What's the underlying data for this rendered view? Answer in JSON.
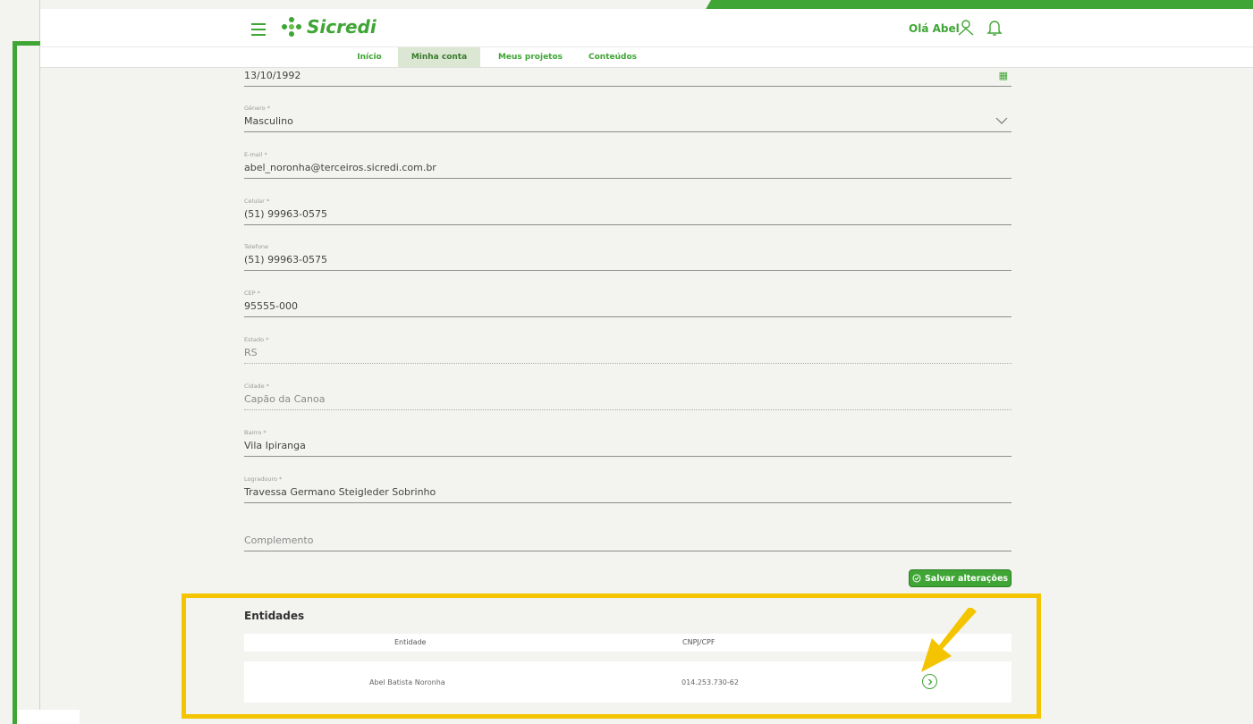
{
  "header": {
    "logo_text": "Sicredi",
    "greeting": "Olá Abel",
    "nav": [
      "Início",
      "Minha conta",
      "Meus projetos",
      "Conteúdos"
    ],
    "active_nav": "Minha conta"
  },
  "form": {
    "birth_date": {
      "value": "13/10/1992"
    },
    "gender": {
      "label": "Gênero *",
      "value": "Masculino"
    },
    "email": {
      "label": "E-mail *",
      "value": "abel_noronha@terceiros.sicredi.com.br"
    },
    "mobile": {
      "label": "Celular *",
      "value": "(51) 99963-0575"
    },
    "phone": {
      "label": "Telefone",
      "value": "(51) 99963-0575"
    },
    "cep": {
      "label": "CEP *",
      "value": "95555-000"
    },
    "state": {
      "label": "Estado *",
      "value": "RS"
    },
    "city": {
      "label": "Cidade *",
      "value": "Capão da Canoa"
    },
    "district": {
      "label": "Bairro *",
      "value": "Vila Ipiranga"
    },
    "street": {
      "label": "Logradouro *",
      "value": "Travessa Germano Steigleder Sobrinho"
    },
    "complement": {
      "placeholder": "Complemento"
    },
    "save_label": "Salvar alterações"
  },
  "entities": {
    "title": "Entidades",
    "columns": [
      "Entidade",
      "CNPJ/CPF"
    ],
    "rows": [
      {
        "entity": "Abel Batista Noronha",
        "document": "014.253.730-62"
      }
    ]
  },
  "colors": {
    "brand_green": "#3fa535",
    "highlight_yellow": "#f5c400"
  }
}
